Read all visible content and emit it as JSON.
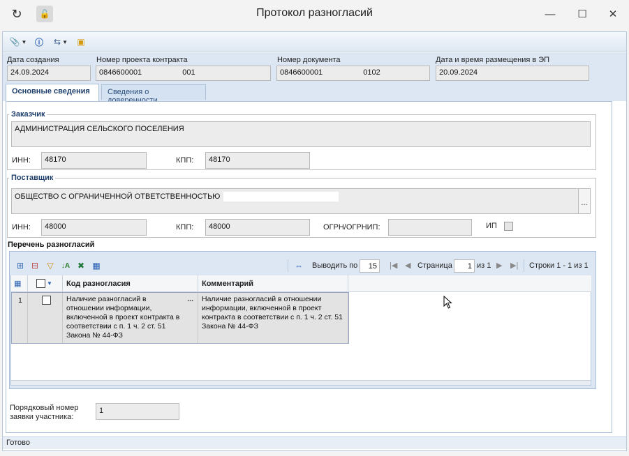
{
  "window": {
    "title": "Протокол разногласий"
  },
  "titlebar": {
    "reload_glyph": "↻",
    "lock_glyph": "🔓",
    "min_glyph": "—",
    "max_glyph": "☐",
    "close_glyph": "✕"
  },
  "toolbar": {
    "items": [
      {
        "name": "attach-icon",
        "glyph": "📎"
      },
      {
        "name": "info-icon",
        "glyph": "ⓘ"
      },
      {
        "name": "link-icon",
        "glyph": "⇆"
      },
      {
        "name": "export-icon",
        "glyph": "▣"
      }
    ]
  },
  "header": {
    "created_label": "Дата создания",
    "created_value": "24.09.2024",
    "contract_label": "Номер проекта контракта",
    "contract_value": "0846600001                   001",
    "doc_label": "Номер документа",
    "doc_value": "0846600001                   0102",
    "placed_label": "Дата и время размещения в ЭП",
    "placed_value": "20.09.2024"
  },
  "tabs": [
    {
      "label": "Основные сведения",
      "active": true
    },
    {
      "label": "Сведения о доверенности",
      "active": false
    }
  ],
  "customer": {
    "title": "Заказчик",
    "name": "АДМИНИСТРАЦИЯ СЕЛЬСКОГО ПОСЕЛЕНИЯ",
    "inn_label": "ИНН:",
    "inn_value": "48170",
    "kpp_label": "КПП:",
    "kpp_value": "48170"
  },
  "supplier": {
    "title": "Поставщик",
    "name": "ОБЩЕСТВО С ОГРАНИЧЕННОЙ ОТВЕТСТВЕННОСТЬЮ",
    "ellipsis": "...",
    "inn_label": "ИНН:",
    "inn_value": "48000",
    "kpp_label": "КПП:",
    "kpp_value": "48000",
    "ogrn_label": "ОГРН/ОГРНИП:",
    "ogrn_value": "",
    "ip_label": "ИП"
  },
  "disagreements": {
    "title": "Перечень разногласий",
    "page_size_label": "Выводить по",
    "page_size": "15",
    "page_label": "Страница",
    "page_value": "1",
    "page_of": "из 1",
    "rows_info": "Строки 1 - 1 из 1",
    "columns": [
      "Код разногласия",
      "Комментарий"
    ],
    "rows": [
      {
        "num": "1",
        "code": "Наличие разногласий в отношении информации, включенной в проект контракта в соответствии с п. 1 ч. 2 ст. 51 Закона № 44-ФЗ",
        "code_more": "...",
        "comment": "Наличие разногласий в отношении информации, включенной в проект контракта в соответствии с п. 1 ч. 2 ст. 51 Закона № 44-ФЗ"
      }
    ]
  },
  "ordinal": {
    "label": "Порядковый номер заявки участника:",
    "value": "1"
  },
  "status": {
    "text": "Готово"
  },
  "colors": {
    "accent": "#1f3f6b",
    "panel": "#dde7f3",
    "field": "#ececec"
  }
}
